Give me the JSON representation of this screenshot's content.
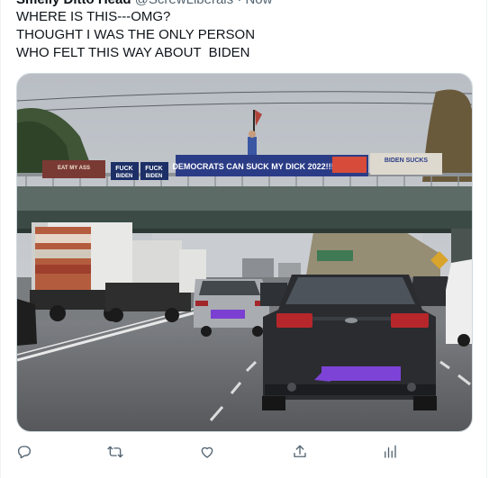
{
  "tweet": {
    "display_name": "Smelly Ditto Head",
    "handle": "@ScrewLiberals",
    "time": "· Now",
    "text_lines": [
      "WHERE IS THIS---OMG?",
      "THOUGHT I WAS THE ONLY PERSON",
      "WHO FELT THIS WAY ABOUT  BIDEN"
    ]
  },
  "image": {
    "banners": {
      "left": "EAT MY ASS",
      "fuck_biden_1_top": "FUCK",
      "fuck_biden_1_bottom": "BIDEN",
      "fuck_biden_2_top": "FUCK",
      "fuck_biden_2_bottom": "BIDEN",
      "main": "DEMOCRATS CAN SUCK MY DICK 2022!!!",
      "right": "BIDEN  SUCKS"
    }
  },
  "actions": {
    "reply": "reply-icon",
    "retweet": "retweet-icon",
    "like": "heart-icon",
    "share": "share-icon",
    "views": "analytics-icon"
  },
  "colors": {
    "icon": "#536471",
    "text": "#0f1419",
    "border": "#cfd9de"
  }
}
